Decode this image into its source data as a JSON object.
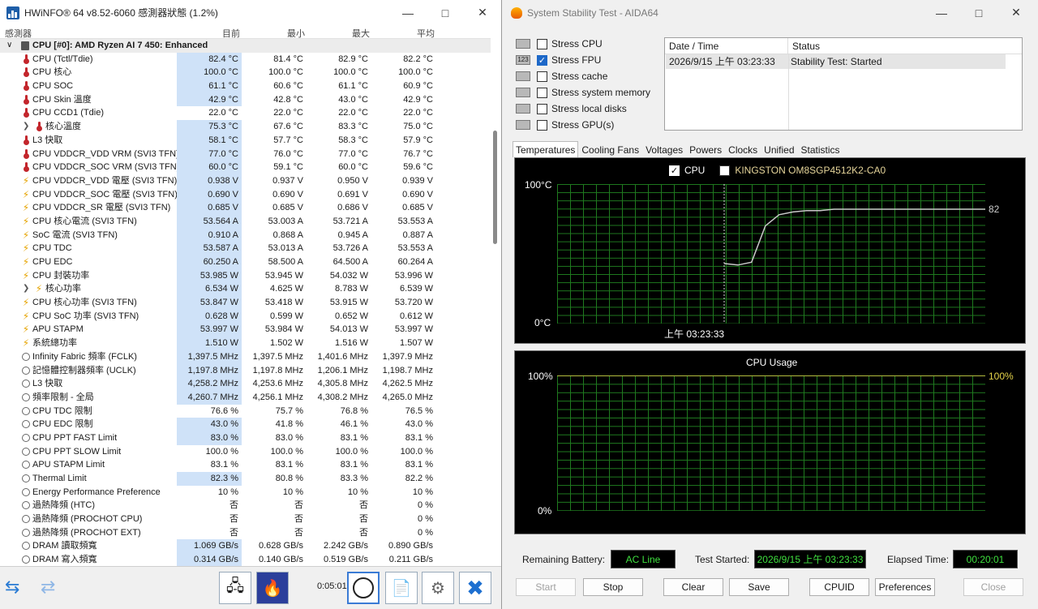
{
  "hwinfo": {
    "title": "HWiNFO® 64 v8.52-6060 感測器狀態 (1.2%)",
    "columns": {
      "sensor": "感測器",
      "current": "目前",
      "min": "最小",
      "max": "最大",
      "avg": "平均"
    },
    "group": "CPU [#0]: AMD Ryzen AI 7 450: Enhanced",
    "rows": [
      {
        "icon": "thermometer-icon",
        "name": "CPU (Tctl/Tdie)",
        "cur": "82.4 °C",
        "min": "81.4 °C",
        "max": "82.9 °C",
        "avg": "82.2 °C",
        "hl": true
      },
      {
        "icon": "thermometer-icon",
        "name": "CPU 核心",
        "cur": "100.0 °C",
        "min": "100.0 °C",
        "max": "100.0 °C",
        "avg": "100.0 °C",
        "hl": true
      },
      {
        "icon": "thermometer-icon",
        "name": "CPU SOC",
        "cur": "61.1 °C",
        "min": "60.6 °C",
        "max": "61.1 °C",
        "avg": "60.9 °C",
        "hl": true
      },
      {
        "icon": "thermometer-icon",
        "name": "CPU Skin 溫度",
        "cur": "42.9 °C",
        "min": "42.8 °C",
        "max": "43.0 °C",
        "avg": "42.9 °C",
        "hl": true
      },
      {
        "icon": "thermometer-icon",
        "name": "CPU CCD1 (Tdie)",
        "cur": "22.0 °C",
        "min": "22.0 °C",
        "max": "22.0 °C",
        "avg": "22.0 °C",
        "hl": false
      },
      {
        "icon": "thermometer-icon",
        "name": "核心溫度",
        "cur": "75.3 °C",
        "min": "67.6 °C",
        "max": "83.3 °C",
        "avg": "75.0 °C",
        "hl": true,
        "sub": true
      },
      {
        "icon": "thermometer-icon",
        "name": "L3 快取",
        "cur": "58.1 °C",
        "min": "57.7 °C",
        "max": "58.3 °C",
        "avg": "57.9 °C",
        "hl": true
      },
      {
        "icon": "thermometer-icon",
        "name": "CPU VDDCR_VDD VRM (SVI3 TFN)",
        "cur": "77.0 °C",
        "min": "76.0 °C",
        "max": "77.0 °C",
        "avg": "76.7 °C",
        "hl": true
      },
      {
        "icon": "thermometer-icon",
        "name": "CPU VDDCR_SOC VRM (SVI3 TFN)",
        "cur": "60.0 °C",
        "min": "59.1 °C",
        "max": "60.0 °C",
        "avg": "59.6 °C",
        "hl": true
      },
      {
        "icon": "bolt-icon",
        "name": "CPU VDDCR_VDD 電壓 (SVI3 TFN)",
        "cur": "0.938 V",
        "min": "0.937 V",
        "max": "0.950 V",
        "avg": "0.939 V",
        "hl": true
      },
      {
        "icon": "bolt-icon",
        "name": "CPU VDDCR_SOC 電壓 (SVI3 TFN)",
        "cur": "0.690 V",
        "min": "0.690 V",
        "max": "0.691 V",
        "avg": "0.690 V",
        "hl": true
      },
      {
        "icon": "bolt-icon",
        "name": "CPU VDDCR_SR 電壓 (SVI3 TFN)",
        "cur": "0.685 V",
        "min": "0.685 V",
        "max": "0.686 V",
        "avg": "0.685 V",
        "hl": true
      },
      {
        "icon": "bolt-icon",
        "name": "CPU 核心電流 (SVI3 TFN)",
        "cur": "53.564 A",
        "min": "53.003 A",
        "max": "53.721 A",
        "avg": "53.553 A",
        "hl": true
      },
      {
        "icon": "bolt-icon",
        "name": "SoC 電流 (SVI3 TFN)",
        "cur": "0.910 A",
        "min": "0.868 A",
        "max": "0.945 A",
        "avg": "0.887 A",
        "hl": true
      },
      {
        "icon": "bolt-icon",
        "name": "CPU TDC",
        "cur": "53.587 A",
        "min": "53.013 A",
        "max": "53.726 A",
        "avg": "53.553 A",
        "hl": true
      },
      {
        "icon": "bolt-icon",
        "name": "CPU EDC",
        "cur": "60.250 A",
        "min": "58.500 A",
        "max": "64.500 A",
        "avg": "60.264 A",
        "hl": true
      },
      {
        "icon": "bolt-icon",
        "name": "CPU 封裝功率",
        "cur": "53.985 W",
        "min": "53.945 W",
        "max": "54.032 W",
        "avg": "53.996 W",
        "hl": true
      },
      {
        "icon": "bolt-icon",
        "name": "核心功率",
        "cur": "6.534 W",
        "min": "4.625 W",
        "max": "8.783 W",
        "avg": "6.539 W",
        "hl": true,
        "sub": true
      },
      {
        "icon": "bolt-icon",
        "name": "CPU 核心功率 (SVI3 TFN)",
        "cur": "53.847 W",
        "min": "53.418 W",
        "max": "53.915 W",
        "avg": "53.720 W",
        "hl": true
      },
      {
        "icon": "bolt-icon",
        "name": "CPU SoC 功率 (SVI3 TFN)",
        "cur": "0.628 W",
        "min": "0.599 W",
        "max": "0.652 W",
        "avg": "0.612 W",
        "hl": true
      },
      {
        "icon": "bolt-icon",
        "name": "APU STAPM",
        "cur": "53.997 W",
        "min": "53.984 W",
        "max": "54.013 W",
        "avg": "53.997 W",
        "hl": true
      },
      {
        "icon": "bolt-icon",
        "name": "系統總功率",
        "cur": "1.510 W",
        "min": "1.502 W",
        "max": "1.516 W",
        "avg": "1.507 W",
        "hl": true
      },
      {
        "icon": "clock-icon",
        "name": "Infinity Fabric 頻率 (FCLK)",
        "cur": "1,397.5 MHz",
        "min": "1,397.5 MHz",
        "max": "1,401.6 MHz",
        "avg": "1,397.9 MHz",
        "hl": true
      },
      {
        "icon": "clock-icon",
        "name": "記憶體控制器頻率 (UCLK)",
        "cur": "1,197.8 MHz",
        "min": "1,197.8 MHz",
        "max": "1,206.1 MHz",
        "avg": "1,198.7 MHz",
        "hl": true
      },
      {
        "icon": "clock-icon",
        "name": "L3 快取",
        "cur": "4,258.2 MHz",
        "min": "4,253.6 MHz",
        "max": "4,305.8 MHz",
        "avg": "4,262.5 MHz",
        "hl": true
      },
      {
        "icon": "clock-icon",
        "name": "頻率限制 - 全局",
        "cur": "4,260.7 MHz",
        "min": "4,256.1 MHz",
        "max": "4,308.2 MHz",
        "avg": "4,265.0 MHz",
        "hl": true
      },
      {
        "icon": "clock-icon",
        "name": "CPU TDC 限制",
        "cur": "76.6 %",
        "min": "75.7 %",
        "max": "76.8 %",
        "avg": "76.5 %",
        "hl": false
      },
      {
        "icon": "clock-icon",
        "name": "CPU EDC 限制",
        "cur": "43.0 %",
        "min": "41.8 %",
        "max": "46.1 %",
        "avg": "43.0 %",
        "hl": true
      },
      {
        "icon": "clock-icon",
        "name": "CPU PPT FAST Limit",
        "cur": "83.0 %",
        "min": "83.0 %",
        "max": "83.1 %",
        "avg": "83.1 %",
        "hl": true
      },
      {
        "icon": "clock-icon",
        "name": "CPU PPT SLOW Limit",
        "cur": "100.0 %",
        "min": "100.0 %",
        "max": "100.0 %",
        "avg": "100.0 %",
        "hl": false
      },
      {
        "icon": "clock-icon",
        "name": "APU STAPM Limit",
        "cur": "83.1 %",
        "min": "83.1 %",
        "max": "83.1 %",
        "avg": "83.1 %",
        "hl": false
      },
      {
        "icon": "clock-icon",
        "name": "Thermal Limit",
        "cur": "82.3 %",
        "min": "80.8 %",
        "max": "83.3 %",
        "avg": "82.2 %",
        "hl": true
      },
      {
        "icon": "clock-icon",
        "name": "Energy Performance Preference",
        "cur": "10 %",
        "min": "10 %",
        "max": "10 %",
        "avg": "10 %",
        "hl": false
      },
      {
        "icon": "clock-icon",
        "name": "過熱降頻 (HTC)",
        "cur": "否",
        "min": "否",
        "max": "否",
        "avg": "0 %",
        "hl": false
      },
      {
        "icon": "clock-icon",
        "name": "過熱降頻 (PROCHOT CPU)",
        "cur": "否",
        "min": "否",
        "max": "否",
        "avg": "0 %",
        "hl": false
      },
      {
        "icon": "clock-icon",
        "name": "過熱降頻 (PROCHOT EXT)",
        "cur": "否",
        "min": "否",
        "max": "否",
        "avg": "0 %",
        "hl": false
      },
      {
        "icon": "clock-icon",
        "name": "DRAM 讀取頻寬",
        "cur": "1.069 GB/s",
        "min": "0.628 GB/s",
        "max": "2.242 GB/s",
        "avg": "0.890 GB/s",
        "hl": true
      },
      {
        "icon": "clock-icon",
        "name": "DRAM 寫入頻寬",
        "cur": "0.314 GB/s",
        "min": "0.140 GB/s",
        "max": "0.519 GB/s",
        "avg": "0.211 GB/s",
        "hl": true
      }
    ],
    "footer": {
      "elapsed": "0:05:01"
    }
  },
  "aida": {
    "title": "System Stability Test - AIDA64",
    "stress": [
      {
        "label": "Stress CPU",
        "checked": false,
        "icon": "cpu-chip-icon"
      },
      {
        "label": "Stress FPU",
        "checked": true,
        "icon": "fpu-icon",
        "icon_text": "123"
      },
      {
        "label": "Stress cache",
        "checked": false,
        "icon": "cache-icon"
      },
      {
        "label": "Stress system memory",
        "checked": false,
        "icon": "memory-icon"
      },
      {
        "label": "Stress local disks",
        "checked": false,
        "icon": "disk-icon"
      },
      {
        "label": "Stress GPU(s)",
        "checked": false,
        "icon": "gpu-icon"
      }
    ],
    "status_table": {
      "col_date": "Date / Time",
      "col_status": "Status",
      "date": "2026/9/15 上午 03:23:33",
      "status": "Stability Test: Started"
    },
    "tabs": [
      "Temperatures",
      "Cooling Fans",
      "Voltages",
      "Powers",
      "Clocks",
      "Unified",
      "Statistics"
    ],
    "temp_graph": {
      "legend_cpu": "CPU",
      "legend_ssd": "KINGSTON OM8SGP4512K2-CA0",
      "y_top": "100°C",
      "y_bottom": "0°C",
      "time_label": "上午 03:23:33",
      "current": "82",
      "colors": {
        "cpu": "#c8c8c8",
        "grid": "#1f7a1f"
      }
    },
    "cpu_graph": {
      "title": "CPU Usage",
      "y_top": "100%",
      "y_bottom": "0%",
      "current": "100%"
    },
    "chart_data": [
      {
        "type": "line",
        "series": [
          {
            "name": "CPU",
            "values": [
              43,
              42,
              44,
              70,
              78,
              80,
              81,
              81,
              82,
              82,
              82,
              82,
              82,
              82,
              82,
              82,
              82,
              82,
              82,
              82
            ]
          }
        ],
        "ylim": [
          0,
          100
        ],
        "title": "",
        "xlabel": "",
        "ylabel": ""
      },
      {
        "type": "line",
        "title": "CPU Usage",
        "series": [
          {
            "values": [
              100,
              100,
              100,
              100,
              100,
              100,
              100,
              100,
              100,
              100
            ]
          }
        ],
        "ylim": [
          0,
          100
        ],
        "xlabel": "",
        "ylabel": ""
      }
    ],
    "info": {
      "battery_label": "Remaining Battery:",
      "battery": "AC Line",
      "started_label": "Test Started:",
      "started": "2026/9/15 上午 03:23:33",
      "elapsed_label": "Elapsed Time:",
      "elapsed": "00:20:01"
    },
    "buttons": {
      "start": "Start",
      "stop": "Stop",
      "clear": "Clear",
      "save": "Save",
      "cpuid": "CPUID",
      "prefs": "Preferences",
      "close": "Close"
    }
  }
}
